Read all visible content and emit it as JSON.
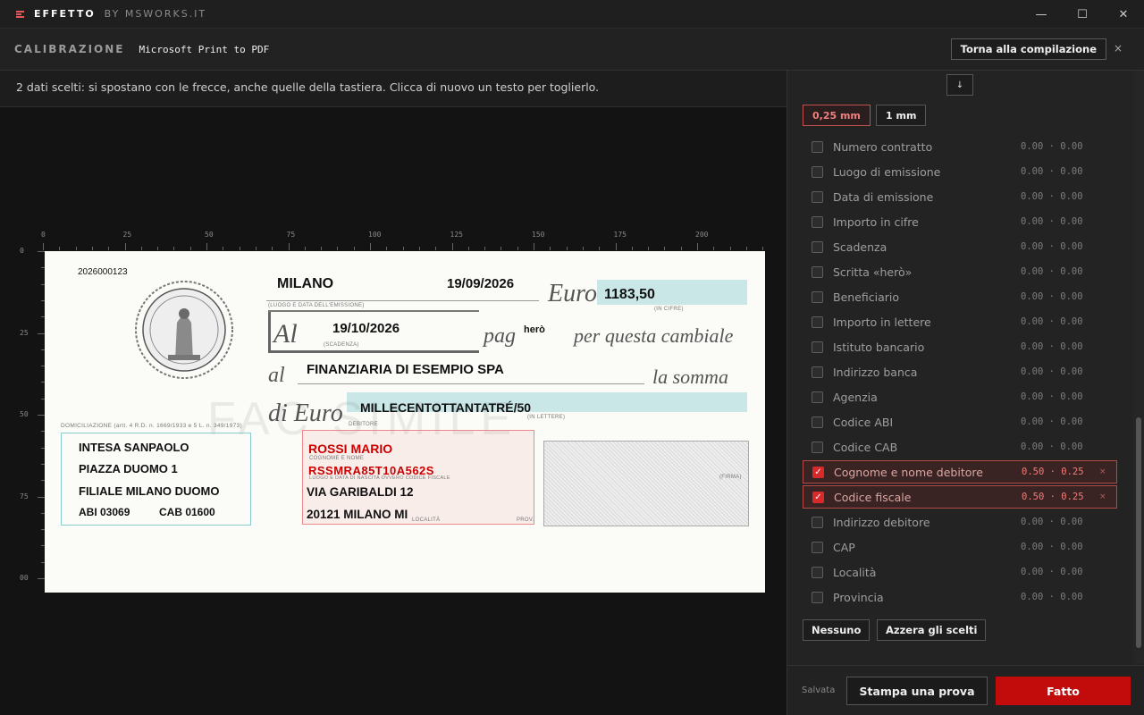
{
  "titlebar": {
    "brand": "EFFETTO",
    "brand_sub": "BY MSWORKS.IT",
    "minimize": "—",
    "maximize": "☐",
    "close": "✕"
  },
  "subbar": {
    "section": "CALIBRAZIONE",
    "printer": "Microsoft Print to PDF",
    "back_button": "Torna alla compilazione",
    "close": "×"
  },
  "hint": "2 dati scelti: si spostano con le frecce, anche quelle della tastiera. Clicca di nuovo un testo per toglierlo.",
  "rulers": {
    "horizontal": [
      "0",
      "25",
      "50",
      "75",
      "100",
      "125",
      "150",
      "175",
      "200"
    ],
    "vertical": [
      "0",
      "25",
      "50",
      "75",
      "00"
    ]
  },
  "check": {
    "number": "2026000123",
    "place": "MILANO",
    "date": "19/09/2026",
    "euro_label": "Euro",
    "amount": "1183,50",
    "in_cifre": "(IN CIFRE)",
    "luogo_label": "(LUOGO E DATA DELL'EMISSIONE)",
    "al_label": "Al",
    "due_date": "19/10/2026",
    "scadenza_label": "(SCADENZA)",
    "pag_label": "pag",
    "hero": "herò",
    "cambiale": "per questa cambiale",
    "al2_label": "al",
    "payee": "FINANZIARIA DI ESEMPIO SPA",
    "somma": "la somma",
    "di_euro": "di Euro",
    "amount_words": "MILLECENTOTTANTATRÉ/50",
    "in_lettere": "(IN LETTERE)",
    "facsimile": "FAC SIMILE",
    "domiciliazione": "DOMICILIAZIONE (artt. 4 R.D. n. 1669/1933 e 5 L. n. 349/1973)",
    "bank_lines": [
      "INTESA SANPAOLO",
      "PIAZZA DUOMO 1",
      "FILIALE MILANO DUOMO"
    ],
    "abi": "ABI  03069",
    "cab": "CAB 01600",
    "debitore_label": "DEBITORE",
    "debtor_name": "ROSSI MARIO",
    "cognome_label": "COGNOME E NOME",
    "tax_code": "RSSMRA85T10A562S",
    "cf_label": "LUOGO E DATA DI NASCITA OVVERO CODICE FISCALE",
    "address": "VIA GARIBALDI 12",
    "city": "20121  MILANO    MI",
    "firma_label": "(FIRMA)",
    "prov_label": "PROV.",
    "localita_label": "LOCALITÀ"
  },
  "panel": {
    "arrow": "↓",
    "steps": [
      "0,25 mm",
      "1 mm"
    ],
    "fields": [
      {
        "label": "Numero contratto",
        "value": "0.00 · 0.00",
        "selected": false
      },
      {
        "label": "Luogo di emissione",
        "value": "0.00 · 0.00",
        "selected": false
      },
      {
        "label": "Data di emissione",
        "value": "0.00 · 0.00",
        "selected": false
      },
      {
        "label": "Importo in cifre",
        "value": "0.00 · 0.00",
        "selected": false
      },
      {
        "label": "Scadenza",
        "value": "0.00 · 0.00",
        "selected": false
      },
      {
        "label": "Scritta «herò»",
        "value": "0.00 · 0.00",
        "selected": false
      },
      {
        "label": "Beneficiario",
        "value": "0.00 · 0.00",
        "selected": false
      },
      {
        "label": "Importo in lettere",
        "value": "0.00 · 0.00",
        "selected": false
      },
      {
        "label": "Istituto bancario",
        "value": "0.00 · 0.00",
        "selected": false
      },
      {
        "label": "Indirizzo banca",
        "value": "0.00 · 0.00",
        "selected": false
      },
      {
        "label": "Agenzia",
        "value": "0.00 · 0.00",
        "selected": false
      },
      {
        "label": "Codice ABI",
        "value": "0.00 · 0.00",
        "selected": false
      },
      {
        "label": "Codice CAB",
        "value": "0.00 · 0.00",
        "selected": false
      },
      {
        "label": "Cognome e nome debitore",
        "value": "0.50 · 0.25",
        "selected": true
      },
      {
        "label": "Codice fiscale",
        "value": "0.50 · 0.25",
        "selected": true
      },
      {
        "label": "Indirizzo debitore",
        "value": "0.00 · 0.00",
        "selected": false
      },
      {
        "label": "CAP",
        "value": "0.00 · 0.00",
        "selected": false
      },
      {
        "label": "Località",
        "value": "0.00 · 0.00",
        "selected": false
      },
      {
        "label": "Provincia",
        "value": "0.00 · 0.00",
        "selected": false
      }
    ],
    "none_button": "Nessuno",
    "reset_button": "Azzera gli scelti",
    "saved": "Salvata",
    "print_button": "Stampa una prova",
    "done_button": "Fatto"
  }
}
